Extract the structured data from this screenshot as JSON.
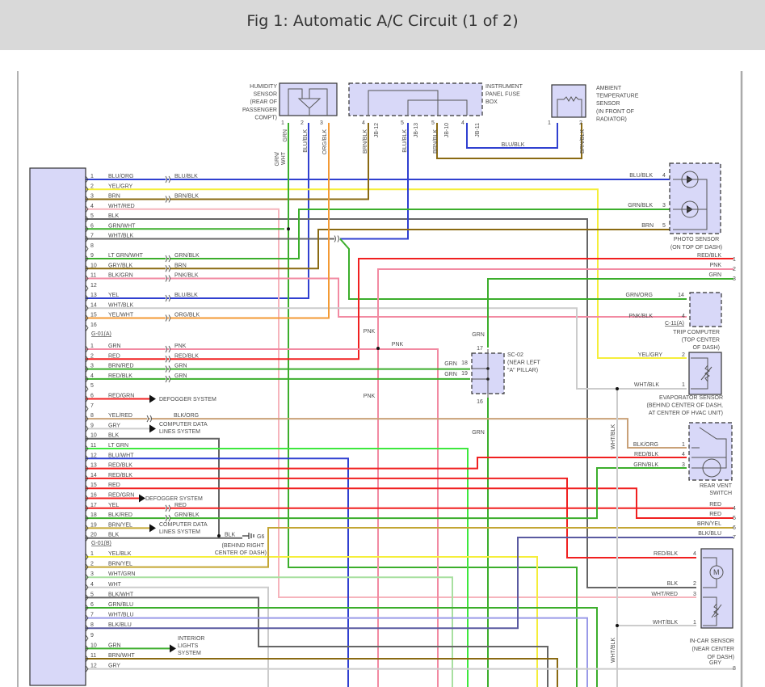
{
  "title": "Fig 1: Automatic A/C Circuit (1 of 2)",
  "connector": {
    "group_a_label": "G-01(A)",
    "group_b_label": "G-01(B)",
    "group_a_pins": [
      {
        "pin": "1",
        "wire": "BLU/ORG"
      },
      {
        "pin": "2",
        "wire": "YEL/GRY"
      },
      {
        "pin": "3",
        "wire": "BRN"
      },
      {
        "pin": "4",
        "wire": "WHT/RED"
      },
      {
        "pin": "5",
        "wire": "BLK"
      },
      {
        "pin": "6",
        "wire": "GRN/WHT"
      },
      {
        "pin": "7",
        "wire": "WHT/BLK"
      },
      {
        "pin": "8",
        "wire": ""
      },
      {
        "pin": "9",
        "wire": "LT GRN/WHT"
      },
      {
        "pin": "10",
        "wire": "GRY/BLK"
      },
      {
        "pin": "11",
        "wire": "BLK/GRN"
      },
      {
        "pin": "12",
        "wire": ""
      },
      {
        "pin": "13",
        "wire": "YEL"
      },
      {
        "pin": "14",
        "wire": "WHT/BLK"
      },
      {
        "pin": "15",
        "wire": "YEL/WHT"
      },
      {
        "pin": "16",
        "wire": ""
      }
    ],
    "group_a2_pins": [
      {
        "pin": "1",
        "wire": "GRN"
      },
      {
        "pin": "2",
        "wire": "RED"
      },
      {
        "pin": "3",
        "wire": "BRN/RED"
      },
      {
        "pin": "4",
        "wire": "RED/BLK"
      },
      {
        "pin": "5",
        "wire": ""
      },
      {
        "pin": "6",
        "wire": "RED/GRN"
      },
      {
        "pin": "7",
        "wire": ""
      },
      {
        "pin": "8",
        "wire": "YEL/RED"
      },
      {
        "pin": "9",
        "wire": "GRY"
      },
      {
        "pin": "10",
        "wire": "BLK"
      },
      {
        "pin": "11",
        "wire": "LT GRN"
      },
      {
        "pin": "12",
        "wire": "BLU/WHT"
      },
      {
        "pin": "13",
        "wire": "RED/BLK"
      },
      {
        "pin": "14",
        "wire": "RED/BLK"
      },
      {
        "pin": "15",
        "wire": "RED"
      },
      {
        "pin": "16",
        "wire": "RED/GRN"
      },
      {
        "pin": "17",
        "wire": "YEL"
      },
      {
        "pin": "18",
        "wire": "BLK/RED"
      },
      {
        "pin": "19",
        "wire": "BRN/YEL"
      },
      {
        "pin": "20",
        "wire": "BLK"
      }
    ],
    "group_b_pins": [
      {
        "pin": "1",
        "wire": "YEL/BLK"
      },
      {
        "pin": "2",
        "wire": "BRN/YEL"
      },
      {
        "pin": "3",
        "wire": "WHT/GRN"
      },
      {
        "pin": "4",
        "wire": "WHT"
      },
      {
        "pin": "5",
        "wire": "BLK/WHT"
      },
      {
        "pin": "6",
        "wire": "GRN/BLU"
      },
      {
        "pin": "7",
        "wire": "WHT/BLU"
      },
      {
        "pin": "8",
        "wire": "BLK/BLU"
      },
      {
        "pin": "9",
        "wire": ""
      },
      {
        "pin": "10",
        "wire": "GRN"
      },
      {
        "pin": "11",
        "wire": "BRN/WHT"
      },
      {
        "pin": "12",
        "wire": "GRY"
      }
    ]
  },
  "components": {
    "humidity_sensor": [
      "HUMIDITY",
      "SENSOR",
      "(REAR OF",
      "PASSENGER",
      "COMPT)"
    ],
    "fuse_box": [
      "INSTRUMENT",
      "PANEL FUSE",
      "BOX"
    ],
    "ambient_sensor": [
      "AMBIENT",
      "TEMPERATURE",
      "SENSOR",
      "(IN FRONT OF",
      "RADIATOR)"
    ],
    "photo_sensor": [
      "PHOTO SENSOR",
      "(ON TOP OF DASH)"
    ],
    "trip_computer": [
      "TRIP COMPUTER",
      "(TOP CENTER",
      "OF DASH)"
    ],
    "trip_connector": "C-11(A)",
    "evaporator_sensor": [
      "EVAPORATOR SENSOR",
      "(BEHIND CENTER OF DASH,",
      "AT CENTER OF HVAC UNIT)"
    ],
    "rear_vent_switch": [
      "REAR VENT",
      "SWITCH"
    ],
    "sc02": [
      "SC-02",
      "(NEAR LEFT",
      "\"A\" PILLAR)"
    ],
    "in_car_sensor": [
      "IN-CAR SENSOR",
      "(NEAR CENTER",
      "OF DASH)"
    ],
    "ground": [
      "G6",
      "(BEHIND RIGHT",
      "CENTER OF DASH)"
    ],
    "defogger_system": "DEFOGGER SYSTEM",
    "computer_data_lines": [
      "COMPUTER DATA",
      "LINES SYSTEM"
    ],
    "interior_lights": [
      "INTERIOR",
      "LIGHTS",
      "SYSTEM"
    ]
  },
  "wire_labels": [
    "GRN",
    "GRN/",
    "WHT",
    "BLU/BLK",
    "ORG/BLK",
    "BRN/BLK",
    "JB-12",
    "BLU/BLK",
    "JB-13",
    "BRN/BLK",
    "JB-10",
    "JB-11",
    "BLU/BLK",
    "BRN/BLK",
    "1",
    "2",
    "3",
    "4",
    "5",
    "5",
    "4",
    "1",
    "2",
    "BLU/BLK",
    "BRN/BLK",
    "GRN/BLK",
    "BRN",
    "PNK/BLK",
    "BLU/BLK",
    "ORG/BLK",
    "PNK",
    "RED/BLK",
    "GRN",
    "GRN",
    "BLK/ORG",
    "RED",
    "GRN/BLK",
    "BLK",
    "BLU/BLK",
    "4",
    "GRN/BLK",
    "3",
    "BRN",
    "5",
    "RED/BLK",
    "1",
    "PNK",
    "2",
    "GRN",
    "3",
    "GRN/ORG",
    "14",
    "PNK/BLK",
    "4",
    "YEL/GRY",
    "2",
    "WHT/BLK",
    "1",
    "BLK/ORG",
    "1",
    "RED/BLK",
    "4",
    "GRN/BLK",
    "3",
    "RED",
    "4",
    "RED",
    "5",
    "BRN/YEL",
    "6",
    "BLK/BLU",
    "7",
    "RED/BLK",
    "4",
    "BLK",
    "2",
    "WHT/RED",
    "3",
    "WHT/BLK",
    "1",
    "GRY",
    "8",
    "PNK",
    "PNK",
    "PNK",
    "GRN",
    "GRN",
    "GRN",
    "18",
    "GRN",
    "19",
    "17",
    "16",
    "WHT/BLK",
    "WHT/BLK"
  ],
  "colors": {
    "blue": "#3040d0",
    "yellow": "#f5ee3a",
    "brown": "#8a6a12",
    "pink": "#f28aa2",
    "light_pink": "#f6b4bc",
    "dark_gray": "#666666",
    "green": "#3cae2c",
    "light_green": "#3ee83e",
    "red": "#f02020",
    "orange": "#f39a34",
    "light_gray": "#cccccc",
    "tan": "#c9a178",
    "lavender": "#9a9ae8",
    "dark_lavender": "#5a5aa0",
    "olive": "#c3a634",
    "pale_green": "#a8e0a0"
  }
}
